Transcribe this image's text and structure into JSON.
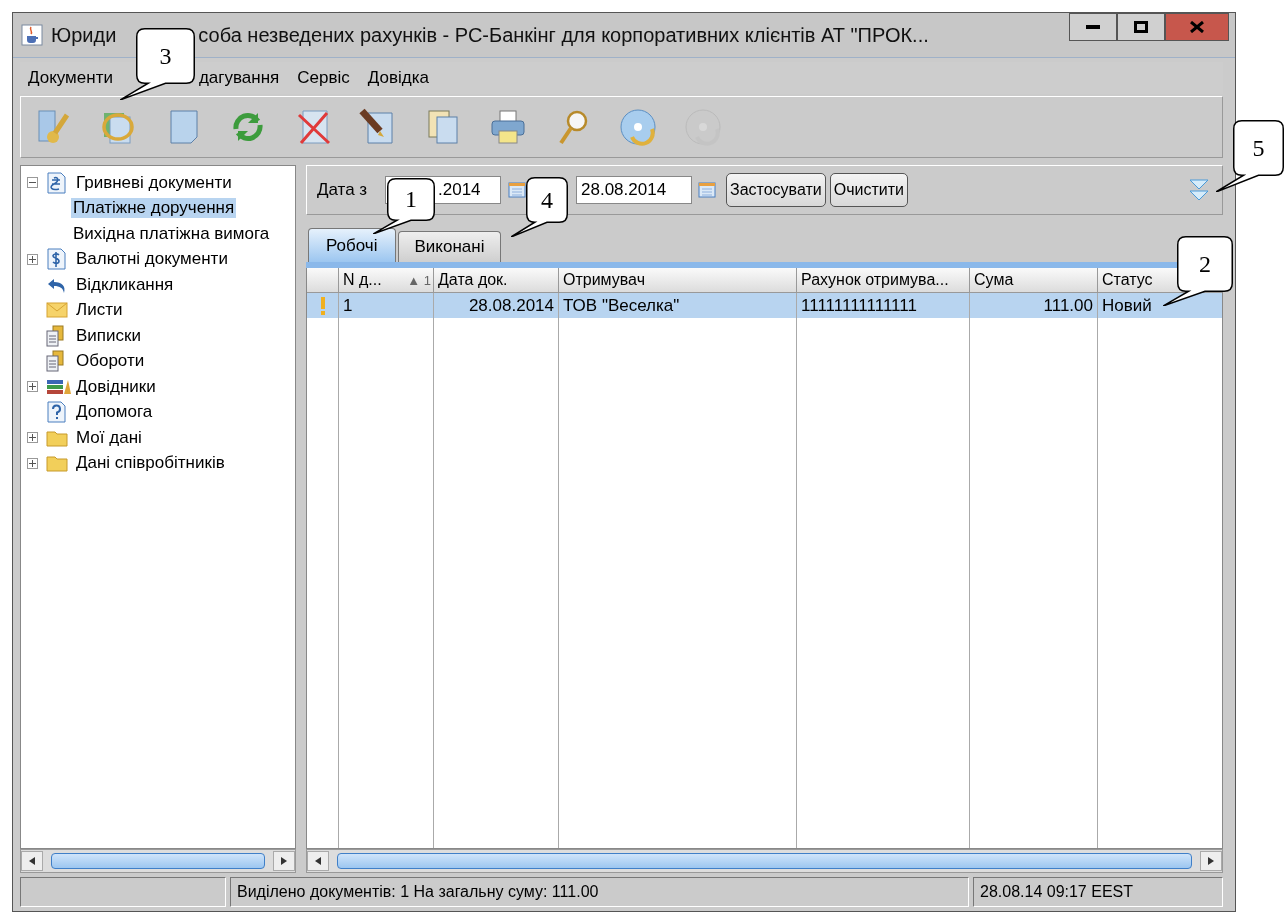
{
  "window": {
    "title_parts": [
      "Юриди",
      "соба незведених рахунків - РС-Банкінг для корпоративних клієнтів АТ \"ПРОК..."
    ]
  },
  "menu": [
    "Документи",
    "дагування",
    "Сервіс",
    "Довідка"
  ],
  "toolbar": [
    {
      "disabled": false
    },
    {
      "disabled": false
    },
    {
      "disabled": false
    },
    {
      "disabled": false
    },
    {
      "disabled": false
    },
    {
      "disabled": false
    },
    {
      "disabled": false
    },
    {
      "disabled": false
    },
    {
      "disabled": false
    },
    {
      "disabled": false
    },
    {
      "disabled": true
    }
  ],
  "tree": [
    {
      "label": "Гривневі документи",
      "kind": "hryvnia",
      "expanded": true,
      "selected": false,
      "children": [
        {
          "label": "Платіжне доручення",
          "selected": true
        },
        {
          "label": "Вихідна платіжна вимога",
          "selected": false
        }
      ]
    },
    {
      "label": "Валютні документи",
      "kind": "currency",
      "expanded": false,
      "selected": false
    },
    {
      "label": "Відкликання",
      "kind": "recall",
      "selected": false
    },
    {
      "label": "Листи",
      "kind": "letters",
      "selected": false
    },
    {
      "label": "Виписки",
      "kind": "statements",
      "selected": false
    },
    {
      "label": "Обороти",
      "kind": "statements",
      "selected": false
    },
    {
      "label": "Довідники",
      "kind": "directories",
      "expanded": false,
      "selected": false
    },
    {
      "label": "Допомога",
      "kind": "help",
      "selected": false
    },
    {
      "label": "Мої дані",
      "kind": "folder",
      "expanded": false,
      "selected": false
    },
    {
      "label": "Дані співробітників",
      "kind": "folder",
      "expanded": false,
      "selected": false
    }
  ],
  "filter": {
    "label": "Дата з",
    "date_from": ".2014",
    "date_to": "28.08.2014",
    "buttons": [
      "Застосувати",
      "Очистити"
    ]
  },
  "tabs": [
    {
      "label": "Робочі",
      "selected": true
    },
    {
      "label": "Виконані",
      "selected": false
    }
  ],
  "table": {
    "columns": [
      {
        "label": "N д...",
        "sort": "▲",
        "sort_index": "1"
      },
      {
        "label": "Дата док."
      },
      {
        "label": "Отримувач"
      },
      {
        "label": "Рахунок отримува..."
      },
      {
        "label": "Сума"
      },
      {
        "label": "Статус"
      }
    ],
    "rows": [
      {
        "selected": true,
        "flag": true,
        "cells": [
          "1",
          "28.08.2014",
          "ТОВ \"Веселка\"",
          "11111111111111",
          "111.00",
          "Новий"
        ]
      }
    ]
  },
  "status_bar": {
    "selection": "Виділено документів: 1 На загальну суму: 111.00",
    "time": "28.08.14 09:17 EEST"
  },
  "callouts": [
    {
      "label": "3",
      "kind": "menu"
    },
    {
      "label": "1",
      "kind": "tab1"
    },
    {
      "label": "4",
      "kind": "tab2"
    },
    {
      "label": "5",
      "kind": "expand"
    },
    {
      "label": "2",
      "kind": "row"
    }
  ]
}
